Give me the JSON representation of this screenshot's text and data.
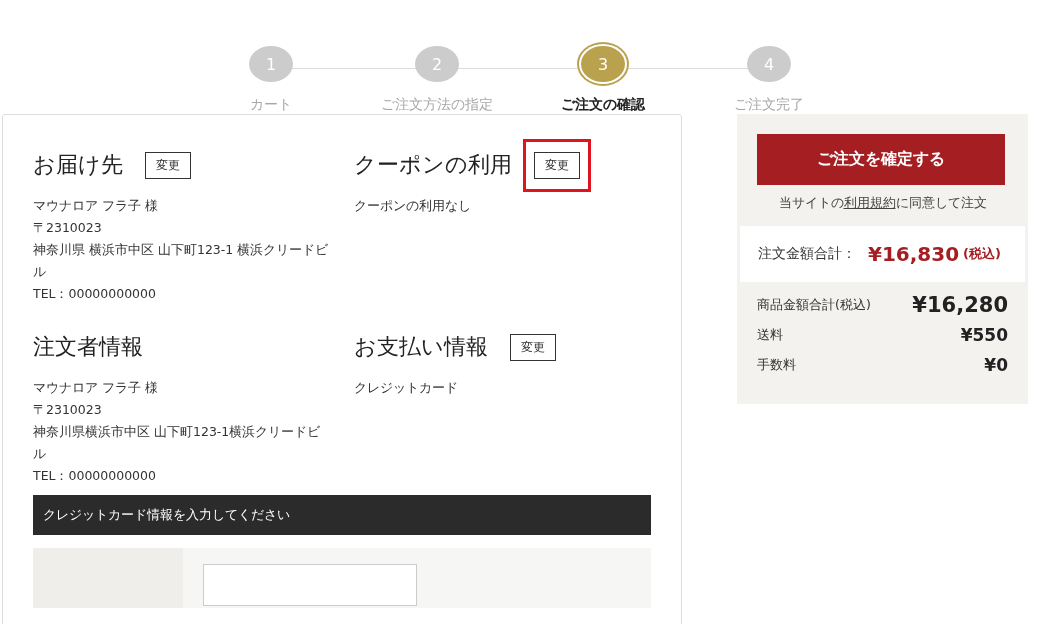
{
  "steps": [
    {
      "number": "1",
      "label": "カート",
      "selected": false
    },
    {
      "number": "2",
      "label": "ご注文方法の指定",
      "selected": false
    },
    {
      "number": "3",
      "label": "ご注文の確認",
      "selected": true
    },
    {
      "number": "4",
      "label": "ご注文完了",
      "selected": false
    }
  ],
  "sections": [
    {
      "title": "お届け先",
      "change_button": "変更",
      "highlighted": false,
      "lines": [
        "マウナロア フラ子 様",
        "〒2310023",
        "神奈川県 横浜市中区 山下町123-1 横浜クリードビル",
        "TEL：00000000000"
      ]
    },
    {
      "title": "クーポンの利用",
      "change_button": "変更",
      "highlighted": true,
      "lines": [
        "クーポンの利用なし"
      ]
    },
    {
      "title": "注文者情報",
      "highlighted": false,
      "lines": [
        "マウナロア フラ子 様",
        "〒2310023",
        "神奈川県横浜市中区 山下町123-1横浜クリードビル",
        "TEL：00000000000"
      ]
    },
    {
      "title": "お支払い情報",
      "change_button": "変更",
      "highlighted": false,
      "lines": [
        "クレジットカード"
      ]
    }
  ],
  "card_panel": {
    "title": "クレジットカード情報を入力してください"
  },
  "summary": {
    "confirm_button": "ご注文を確定する",
    "agreement_prefix": "当サイトの",
    "agreement_link": "利用規約",
    "agreement_suffix": "に同意して注文",
    "total_label": "注文金額合計：",
    "total_value": "¥16,830",
    "total_note": "(税込)",
    "rows": [
      {
        "label": "商品金額合計(税込)",
        "value": "¥16,280",
        "emphasis": true
      },
      {
        "label": "送料",
        "value": "¥550",
        "emphasis": false
      },
      {
        "label": "手数料",
        "value": "¥0",
        "emphasis": false
      }
    ]
  }
}
